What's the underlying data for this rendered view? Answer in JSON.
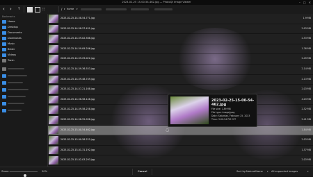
{
  "window": {
    "title": "2023-02-25 15-00-54-462.jpg — PhotoQt Image Viewer",
    "controls": [
      "–",
      "□",
      "✕"
    ]
  },
  "toolbar": {
    "back_icon": "chevron-left-icon",
    "forward_icon": "chevron-right-icon",
    "up_icon": "arrow-up-icon",
    "crumb_home": "home"
  },
  "sidebar": {
    "title": "Bookmarks",
    "items": [
      {
        "label": "Home"
      },
      {
        "label": "Desktop"
      },
      {
        "label": "Documents"
      },
      {
        "label": "Downloads"
      },
      {
        "label": "Music"
      },
      {
        "label": "Bilder"
      },
      {
        "label": "Videos"
      },
      {
        "label": "Trash"
      }
    ]
  },
  "files": [
    {
      "name": "2023-02-25-14-58-54-771.jpg",
      "size": "1.9 MB"
    },
    {
      "name": "2023-02-25-14-58-57-451.jpg",
      "size": "2.03 MB"
    },
    {
      "name": "2023-02-25-14-59-02-588.jpg",
      "size": "2.53 MB"
    },
    {
      "name": "2023-02-25-14-59-09-206.jpg",
      "size": "1.76 MB"
    },
    {
      "name": "2023-02-25-14-59-29-022.jpg",
      "size": "2.49 MB"
    },
    {
      "name": "2023-02-25-14-59-36-553.jpg",
      "size": "2.14 MB"
    },
    {
      "name": "2023-02-25-14-59-48-749.jpg",
      "size": "2.13 MB"
    },
    {
      "name": "2023-02-25-14-57-21-168.jpg",
      "size": "2.03 MB"
    },
    {
      "name": "2023-02-25-14-58-58-148.jpg",
      "size": "4.03 MB"
    },
    {
      "name": "2023-02-25-14-59-58-258.jpg",
      "size": "2.52 MB"
    },
    {
      "name": "2023-02-25-14-58-55-038.jpg",
      "size": "2.41 MB"
    },
    {
      "name": "2023-02-25-15-00-54-462.jpg",
      "size": "1.84 MB"
    },
    {
      "name": "2023-02-25-15-00-58-225.jpg",
      "size": "2.03 MB"
    },
    {
      "name": "2023-02-25-15-01-31-192.jpg",
      "size": "1.57 MB"
    },
    {
      "name": "2023-02-25-15-02-03-293.jpg",
      "size": "2.03 MB"
    }
  ],
  "selected_index": 11,
  "tooltip": {
    "title": "2023-02-25-15-00-54-462.jpg",
    "lines": [
      "File size: 1.89 MB",
      "File type: image/jpeg",
      "Date: Saturday, February 25, 2023",
      "Time: 3:00:54 PM CST"
    ]
  },
  "status": {
    "zoom_label": "Zoom:",
    "zoom_value": "50%",
    "zoom_level": 0.55,
    "cancel_label": "Cancel",
    "sort_label": "Sort by:",
    "sort_value": "NaturalName",
    "filter_value": "All supported images"
  }
}
